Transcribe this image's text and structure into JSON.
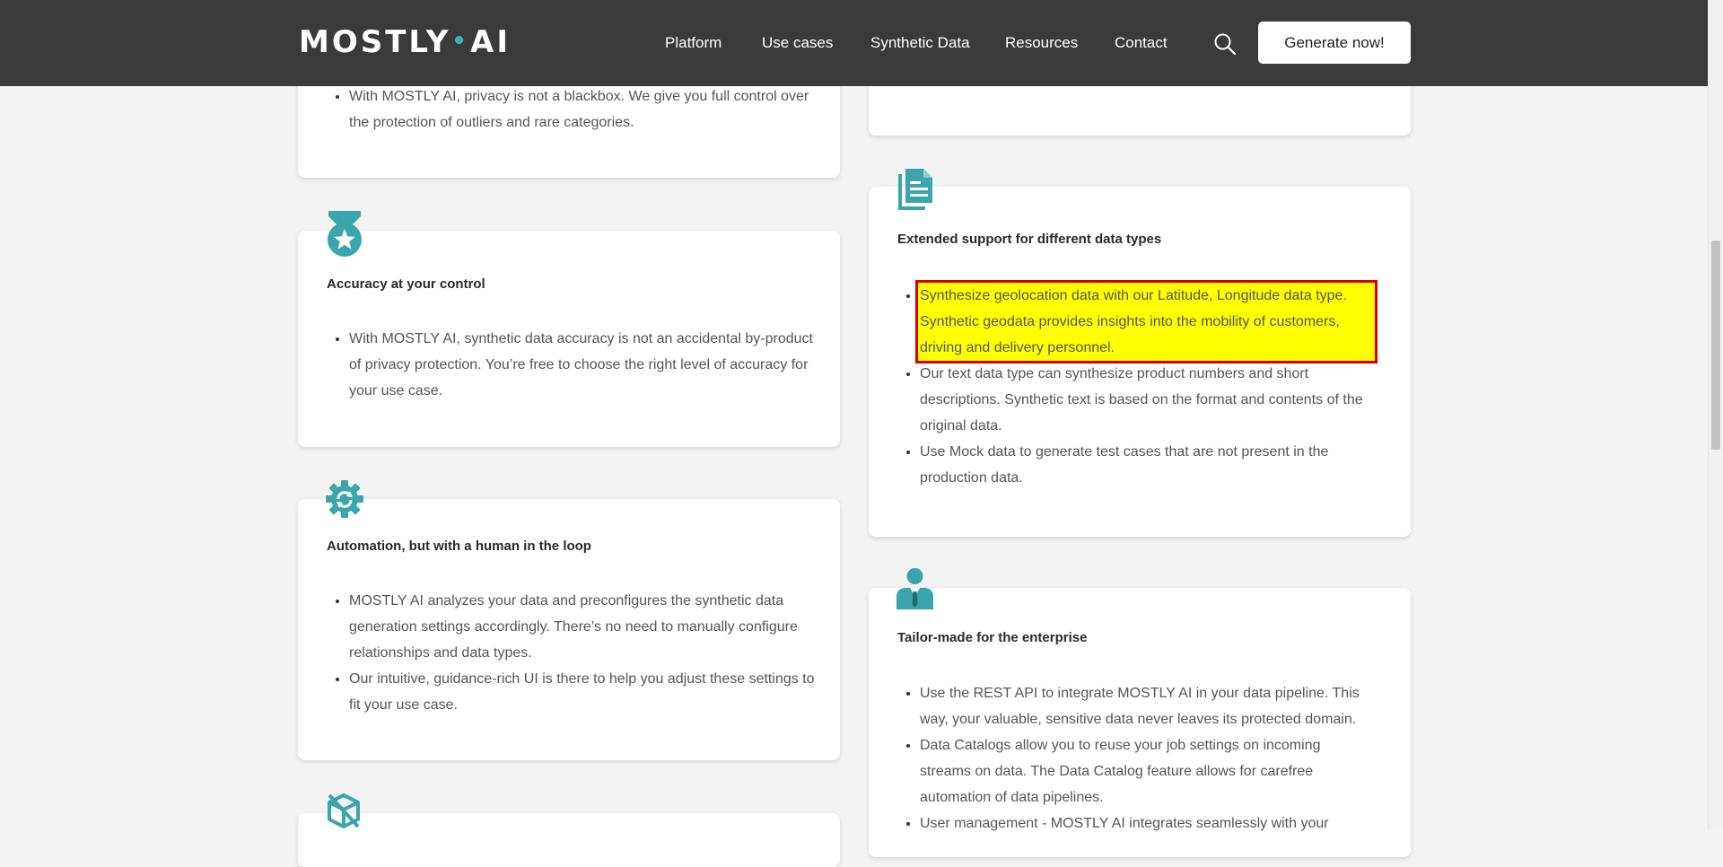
{
  "header": {
    "logo_left": "MOSTLY",
    "logo_dot": "•",
    "logo_right": "AI",
    "nav": [
      "Platform",
      "Use cases",
      "Synthetic Data",
      "Resources",
      "Contact"
    ],
    "cta_label": "Generate now!"
  },
  "colors": {
    "header_bg": "#3a3a3a",
    "accent_teal": "#3bb3b7",
    "highlight": "#ffff00",
    "highlight_border": "#d40000"
  },
  "left": {
    "privacy_card": {
      "bullets": [
        "With MOSTLY AI, privacy is not a blackbox. We give you full control over the protection of outliers and rare categories."
      ]
    },
    "accuracy_card": {
      "icon": "medal-icon",
      "title": "Accuracy at your control",
      "bullets": [
        "With MOSTLY AI, synthetic data accuracy is not an accidental by-product of privacy protection. You’re free to choose the right level of accuracy for your use case."
      ]
    },
    "automation_card": {
      "icon": "gear-icon",
      "title": "Automation, but with a human in the loop",
      "bullets": [
        "MOSTLY AI analyzes your data and preconfigures the synthetic data generation settings accordingly. There’s no need to manually configure relationships and data types.",
        "Our intuitive, guidance-rich UI is there to help you adjust these settings to fit your use case."
      ]
    },
    "next_card": {
      "icon": "cube-icon"
    }
  },
  "right": {
    "data_types_card": {
      "icon": "document-icon",
      "title": "Extended support for different data types",
      "bullets": [
        "Synthesize geolocation data with our Latitude, Longitude data type. Synthetic geodata provides insights into the mobility of customers, driving and delivery personnel.",
        "Our text data type can synthesize product numbers and short descriptions. Synthetic text is based on the format and contents of the original data.",
        "Use Mock data to generate test cases that are not present in the production data."
      ]
    },
    "enterprise_card": {
      "icon": "businessman-icon",
      "title": "Tailor-made for the enterprise",
      "bullets": [
        "Use the REST API to integrate MOSTLY AI in your data pipeline. This way, your valuable, sensitive data never leaves its protected domain.",
        "Data Catalogs allow you to reuse your job settings on incoming streams on data. The Data Catalog feature allows for carefree automation of data pipelines.",
        "User management - MOSTLY AI integrates seamlessly with your"
      ]
    }
  }
}
